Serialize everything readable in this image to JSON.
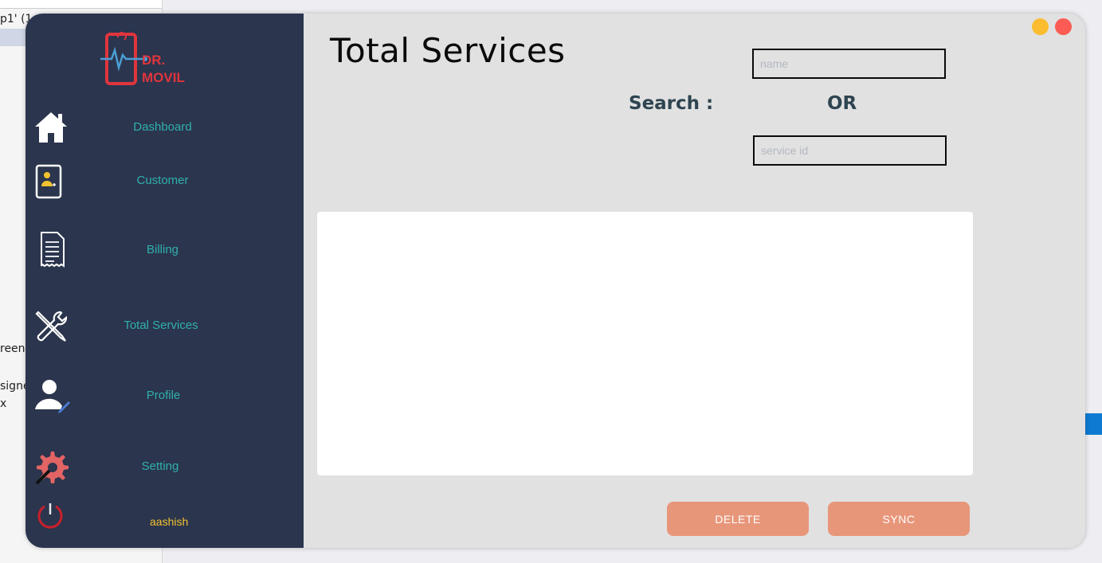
{
  "background": {
    "fragments": [
      "p1' (1",
      "reen.",
      "signe",
      "x"
    ]
  },
  "sidebar": {
    "logo": {
      "line1": "DR.",
      "line2": "MOVIL",
      "icon": "phone-heartbeat-logo"
    },
    "items": [
      {
        "label": "Dashboard",
        "icon": "home-icon"
      },
      {
        "label": "Customer",
        "icon": "customer-card-icon"
      },
      {
        "label": "Billing",
        "icon": "receipt-icon"
      },
      {
        "label": "Total Services",
        "icon": "wrench-screwdriver-icon"
      },
      {
        "label": "Profile",
        "icon": "user-edit-icon"
      },
      {
        "label": "Setting",
        "icon": "gear-icon"
      }
    ],
    "user": {
      "name": "aashish",
      "icon": "power-icon"
    }
  },
  "main": {
    "title": "Total Services",
    "search_label": "Search :",
    "or_label": "OR",
    "name_placeholder": "name",
    "service_id_placeholder": "service id",
    "delete_label": "DELETE",
    "sync_label": "SYNC"
  },
  "window_controls": {
    "minimize_color": "#fbbd2f",
    "close_color": "#fa5b53"
  },
  "colors": {
    "sidebar_bg": "#2b354d",
    "nav_text": "#2fb0ac",
    "user_text": "#f2c230",
    "button_bg": "#e8967a",
    "content_bg": "#e1e1e1"
  }
}
